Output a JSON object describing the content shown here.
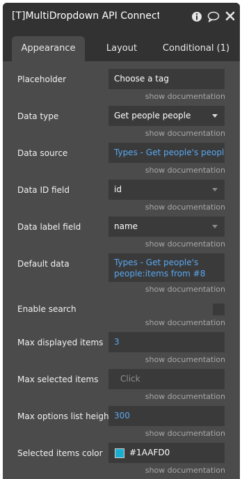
{
  "window": {
    "title": "[T]MultiDropdown API Connectc",
    "icons": [
      "info-icon",
      "comment-icon",
      "close-icon"
    ]
  },
  "tabs": [
    {
      "label": "Appearance",
      "active": true
    },
    {
      "label": "Layout",
      "active": false
    },
    {
      "label": "Conditional (1)",
      "active": false
    }
  ],
  "doc_link": "show documentation",
  "fields": {
    "placeholder": {
      "label": "Placeholder",
      "value": "Choose a tag"
    },
    "data_type": {
      "label": "Data type",
      "value": "Get people people"
    },
    "data_source": {
      "label": "Data source",
      "value": "Types - Get people's people"
    },
    "data_id_field": {
      "label": "Data ID field",
      "value": "id"
    },
    "data_label_field": {
      "label": "Data label field",
      "value": "name"
    },
    "default_data": {
      "label": "Default data",
      "value": "Types - Get people's people:items from #8"
    },
    "enable_search": {
      "label": "Enable search",
      "checked": false
    },
    "max_displayed_items": {
      "label": "Max displayed items",
      "value": "3"
    },
    "max_selected_items": {
      "label": "Max selected items",
      "placeholder": "Click"
    },
    "max_options_list_height": {
      "label": "Max options list heigh",
      "value": "300"
    },
    "selected_items_color": {
      "label": "Selected items color",
      "value": "#1AAFD0",
      "color": "#1AAFD0"
    }
  },
  "colors": {
    "panel": "#4b4b4b",
    "titlebar": "#323232",
    "field": "#3a3a3a",
    "link": "#5aa8f0"
  }
}
